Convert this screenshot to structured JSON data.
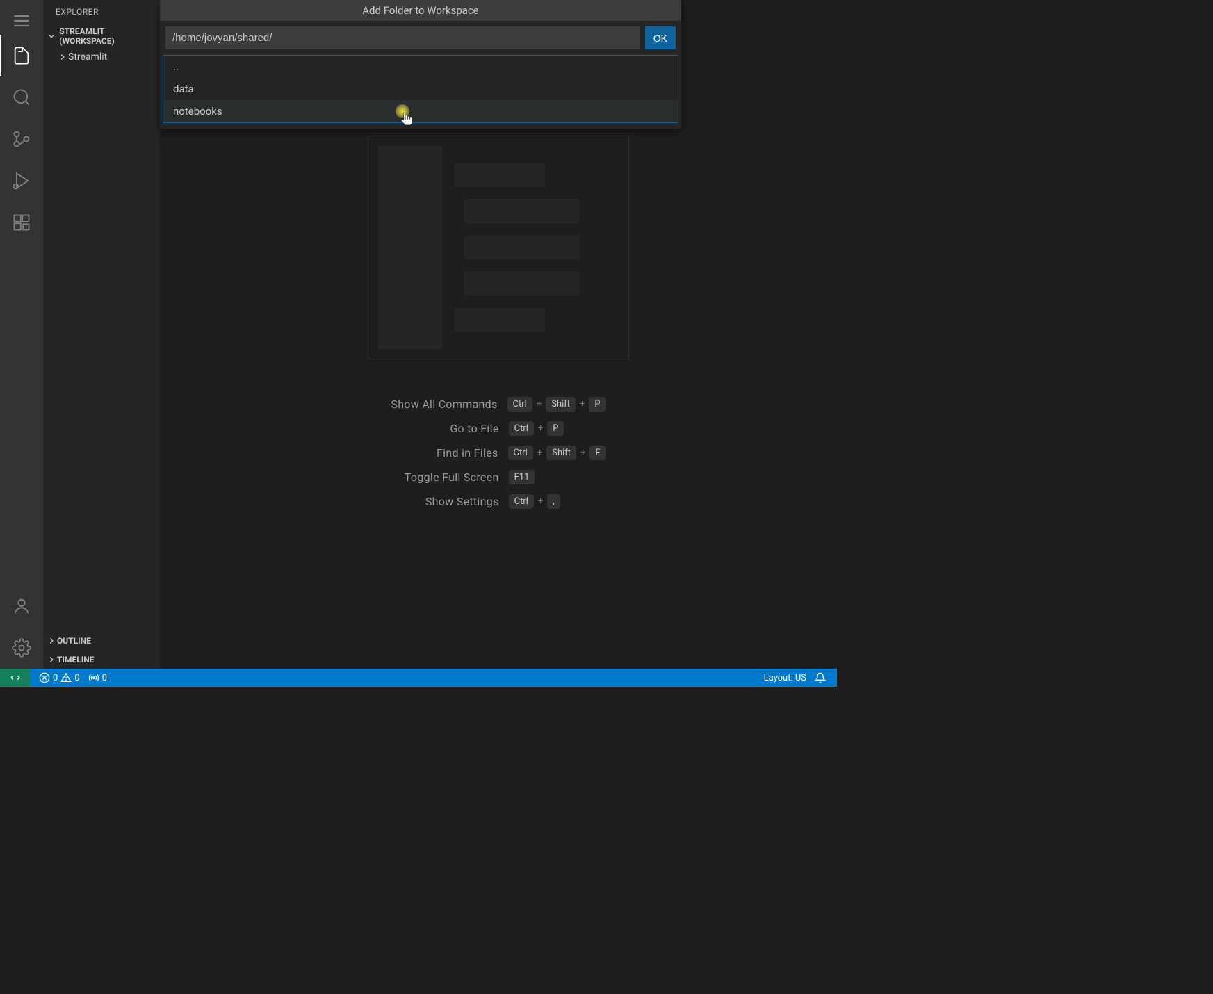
{
  "sidebar": {
    "title": "EXPLORER",
    "workspace_label": "STREAMLIT (WORKSPACE)",
    "tree_items": [
      "Streamlit"
    ],
    "panels": [
      "OUTLINE",
      "TIMELINE"
    ]
  },
  "dialog": {
    "title": "Add Folder to Workspace",
    "path": "/home/jovyan/shared/",
    "ok_label": "OK",
    "entries": [
      "..",
      "data",
      "notebooks"
    ]
  },
  "shortcuts": [
    {
      "label": "Show All Commands",
      "keys": [
        "Ctrl",
        "+",
        "Shift",
        "+",
        "P"
      ]
    },
    {
      "label": "Go to File",
      "keys": [
        "Ctrl",
        "+",
        "P"
      ]
    },
    {
      "label": "Find in Files",
      "keys": [
        "Ctrl",
        "+",
        "Shift",
        "+",
        "F"
      ]
    },
    {
      "label": "Toggle Full Screen",
      "keys": [
        "F11"
      ]
    },
    {
      "label": "Show Settings",
      "keys": [
        "Ctrl",
        "+",
        ","
      ]
    }
  ],
  "status": {
    "errors": "0",
    "warnings": "0",
    "ports": "0",
    "layout": "Layout: US"
  }
}
